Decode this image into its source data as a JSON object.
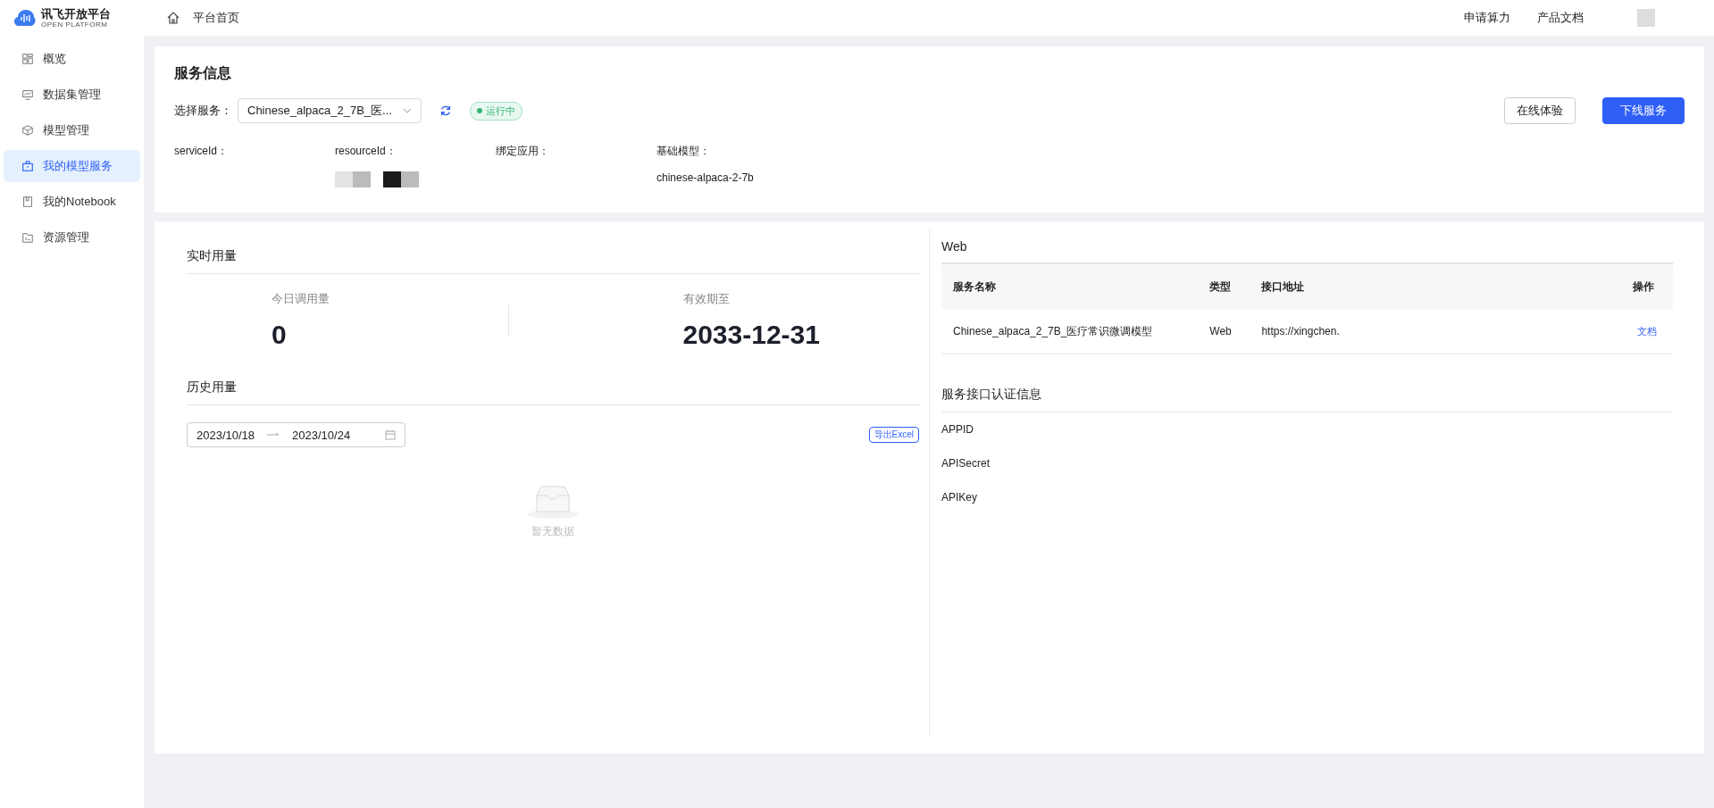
{
  "header": {
    "logo_title": "讯飞开放平台",
    "logo_subtitle": "OPEN PLATFORM",
    "breadcrumb": "平台首页",
    "links": [
      "申请算力",
      "产品文档"
    ]
  },
  "sidebar": {
    "items": [
      {
        "label": "概览",
        "selected": false
      },
      {
        "label": "数据集管理",
        "selected": false
      },
      {
        "label": "模型管理",
        "selected": false
      },
      {
        "label": "我的模型服务",
        "selected": true
      },
      {
        "label": "我的Notebook",
        "selected": false
      },
      {
        "label": "资源管理",
        "selected": false
      }
    ]
  },
  "service_info": {
    "title": "服务信息",
    "select_label": "选择服务：",
    "select_value": "Chinese_alpaca_2_7B_医...",
    "status": "运行中",
    "buttons": [
      {
        "label": "在线体验",
        "kind": "default"
      },
      {
        "label": "下线服务",
        "kind": "primary"
      }
    ],
    "fields": [
      {
        "label": "serviceId："
      },
      {
        "label": "resourceId："
      },
      {
        "label": "绑定应用："
      },
      {
        "label": "基础模型：",
        "value": "chinese-alpaca-2-7b"
      }
    ]
  },
  "realtime": {
    "title": "实时用量",
    "stats": [
      {
        "label": "今日调用量",
        "value": "0"
      },
      {
        "label": "有效期至",
        "value": "2033-12-31"
      }
    ]
  },
  "history": {
    "title": "历史用量",
    "start_date": "2023/10/18",
    "end_date": "2023/10/24",
    "export": "导出Excel",
    "empty": "暂无数据"
  },
  "web": {
    "title": "Web",
    "columns": [
      "服务名称",
      "类型",
      "接口地址",
      "操作"
    ],
    "rows": [
      {
        "name": "Chinese_alpaca_2_7B_医疗常识微调模型",
        "type": "Web",
        "url": "https://xingchen.",
        "action": "文档"
      }
    ]
  },
  "auth": {
    "title": "服务接口认证信息",
    "fields": [
      "APPID",
      "APISecret",
      "APIKey"
    ]
  }
}
